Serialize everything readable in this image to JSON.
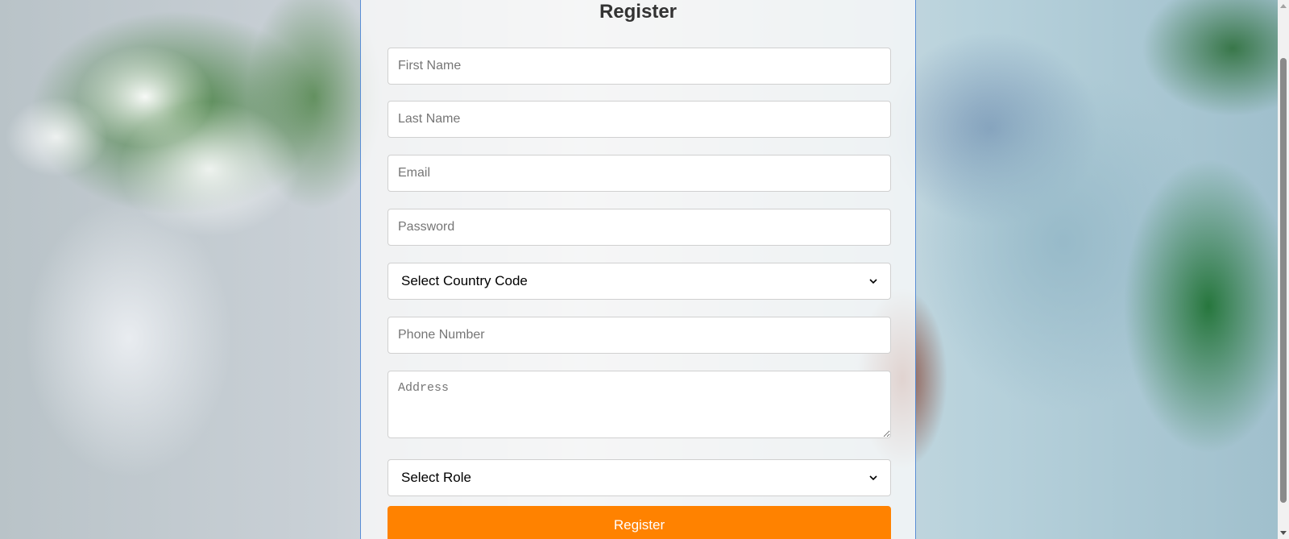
{
  "form": {
    "title": "Register",
    "first_name_placeholder": "First Name",
    "last_name_placeholder": "Last Name",
    "email_placeholder": "Email",
    "password_placeholder": "Password",
    "country_code_select": "Select Country Code",
    "phone_placeholder": "Phone Number",
    "address_placeholder": "Address",
    "role_select": "Select Role",
    "submit_label": "Register"
  },
  "colors": {
    "submit_button": "#ff8200",
    "panel_border": "#5a8fd6"
  },
  "icons": {
    "select_chevron": "chevron-down-icon"
  }
}
